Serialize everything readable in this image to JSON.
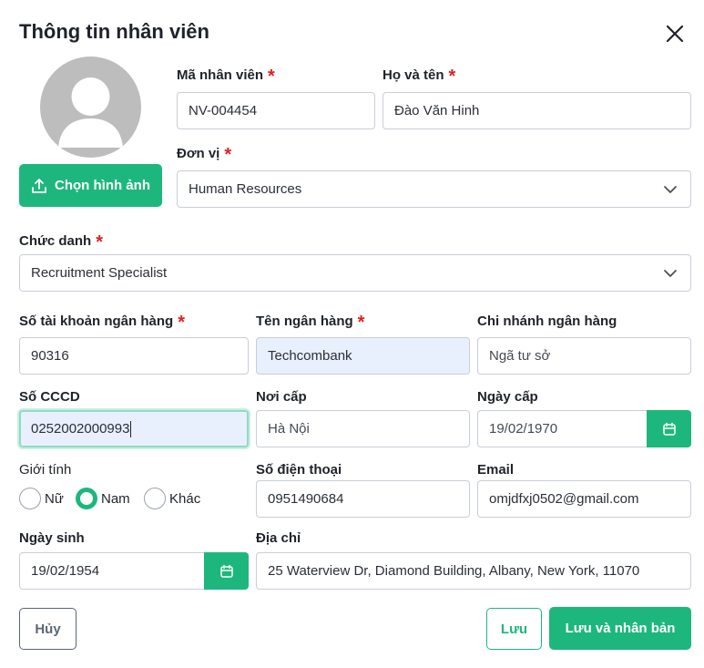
{
  "dialog": {
    "title": "Thông tin nhân viên",
    "upload_label": "Chọn hình ảnh"
  },
  "fields": {
    "employee_code": {
      "label": "Mã nhân viên",
      "value": "NV-004454"
    },
    "full_name": {
      "label": "Họ và tên",
      "value": "Đào Văn Hinh"
    },
    "department": {
      "label": "Đơn vị",
      "value": "Human Resources"
    },
    "position": {
      "label": "Chức danh",
      "value": "Recruitment Specialist"
    },
    "bank_account": {
      "label": "Số tài khoản ngân hàng",
      "value": "90316"
    },
    "bank_name": {
      "label": "Tên ngân hàng",
      "value": "Techcombank"
    },
    "bank_branch": {
      "label": "Chi nhánh ngân hàng",
      "placeholder": "Ngã tư sở"
    },
    "id_number": {
      "label": "Số CCCD",
      "value": "0252002000993"
    },
    "issue_place": {
      "label": "Nơi cấp",
      "placeholder": "Hà Nội"
    },
    "issue_date": {
      "label": "Ngày cấp",
      "placeholder": "19/02/1970"
    },
    "gender": {
      "label": "Giới tính",
      "options": [
        "Nữ",
        "Nam",
        "Khác"
      ],
      "selected": "Nam"
    },
    "phone": {
      "label": "Số điện thoại",
      "value": "0951490684"
    },
    "email": {
      "label": "Email",
      "value": "omjdfxj0502@gmail.com"
    },
    "birth_date": {
      "label": "Ngày sinh",
      "value": "19/02/1954"
    },
    "address": {
      "label": "Địa chỉ",
      "value": "25 Waterview Dr, Diamond Building, Albany, New York, 11070"
    }
  },
  "required_mark": "*",
  "footer": {
    "cancel_label": "Hủy",
    "save_label": "Lưu",
    "save_duplicate_label": "Lưu và nhân bản"
  },
  "colors": {
    "accent": "#1db77d",
    "required": "#e02020",
    "highlight_field": "#e8f0fe"
  },
  "icons": [
    "close-icon",
    "avatar-placeholder",
    "upload-icon",
    "chevron-down-icon",
    "calendar-icon"
  ]
}
